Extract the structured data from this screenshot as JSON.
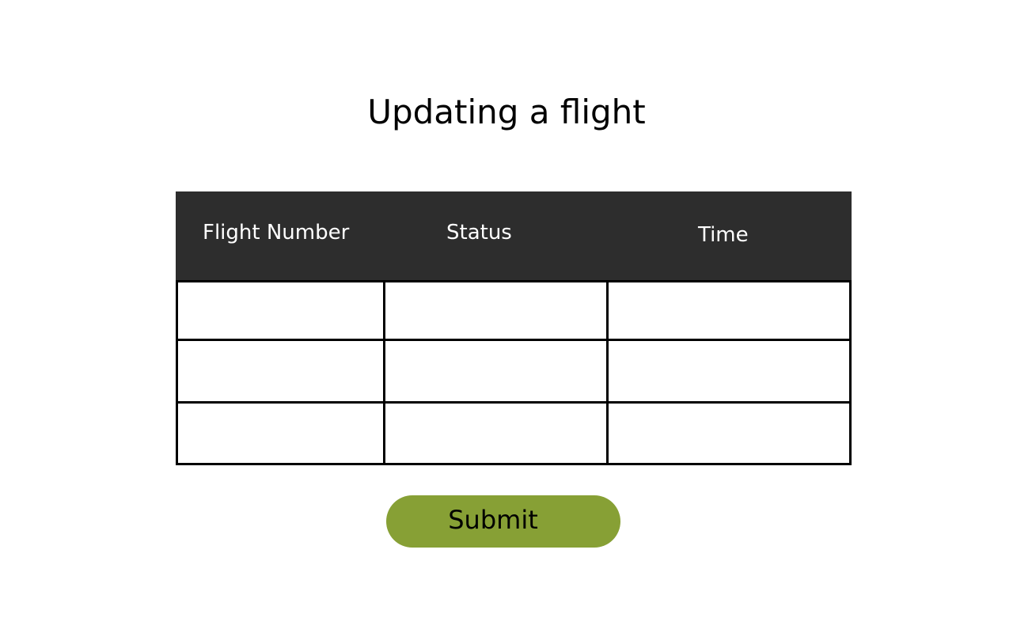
{
  "page": {
    "title": "Updating a flight"
  },
  "table": {
    "headers": [
      "Flight Number",
      "Status",
      "Time"
    ],
    "rows": [
      [
        "",
        "",
        ""
      ],
      [
        "",
        "",
        ""
      ],
      [
        "",
        "",
        ""
      ]
    ],
    "header_bg": "#2d2d2d",
    "header_text_color": "#ffffff"
  },
  "actions": {
    "submit_label": "Submit",
    "submit_color": "#87a035"
  }
}
